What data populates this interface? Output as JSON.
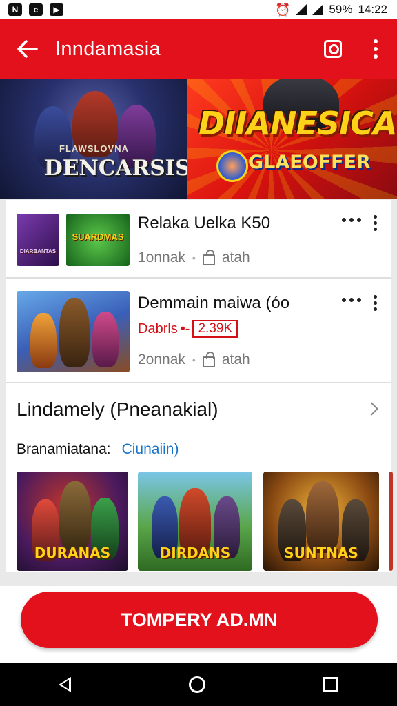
{
  "status_bar": {
    "icons": [
      "N",
      "e",
      "▶"
    ],
    "battery": "59%",
    "time": "14:22"
  },
  "app_bar": {
    "title": "Inndamasia"
  },
  "banner": {
    "left_subtitle": "FLAWSLOVNA",
    "left_logo": "DENCARSIS",
    "right_logo": "DIIANESICA",
    "right_logo_2": "GLAEOFFER"
  },
  "list": {
    "items": [
      {
        "title": "Relaka Uelka K50",
        "thumb1_text": "DIARBANTAS",
        "thumb2_text": "SUARDMAS",
        "meta_left": "1onnak",
        "meta_right": "atah"
      },
      {
        "title": "Demmain maiwa (óo",
        "tag_text": "Dabrls",
        "tag_box": "2.39K",
        "meta_left": "2onnak",
        "meta_right": "atah"
      }
    ]
  },
  "section": {
    "title": "Lindamely (Pneanakial)",
    "subtitle_label": "Branamiatana:",
    "subtitle_link": "Ciunaiin)",
    "games": [
      {
        "name": "DURANAS"
      },
      {
        "name": "DIRDANS"
      },
      {
        "name": "SUNTNAS"
      }
    ]
  },
  "cta": {
    "label": "TOMPERY AD.MN"
  },
  "colors": {
    "accent": "#e3111b",
    "link": "#1a73c6"
  }
}
